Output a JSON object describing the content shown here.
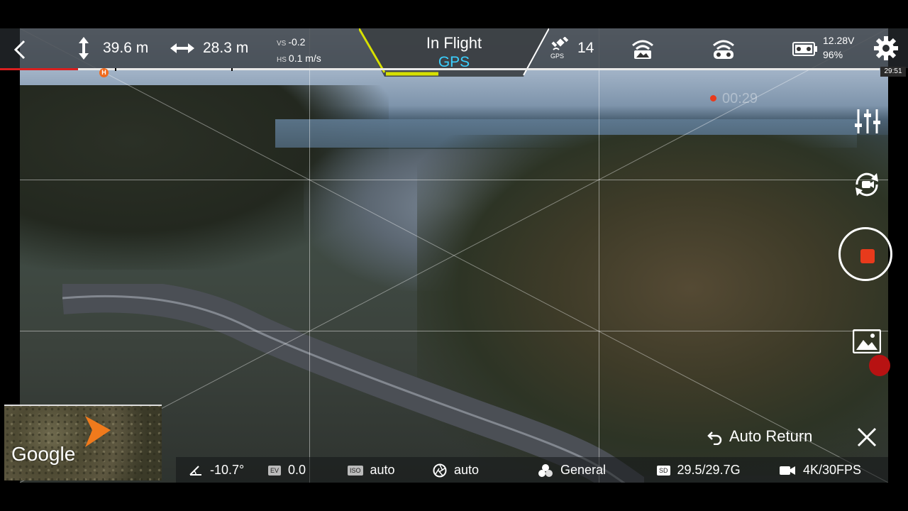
{
  "telemetry": {
    "altitude": "39.6 m",
    "distance": "28.3 m",
    "vs_label": "VS",
    "vs_value": "-0.2",
    "hs_label": "HS",
    "hs_value": "0.1 m/s"
  },
  "flight_status": {
    "state": "In Flight",
    "positioning": "GPS"
  },
  "gps": {
    "label": "GPS",
    "satellites": "14"
  },
  "battery": {
    "voltage": "12.28V",
    "percent": "96%"
  },
  "flight_time_remaining": "29:51",
  "home_marker": "H",
  "recording": {
    "elapsed": "00:29"
  },
  "bottom_bar": {
    "gimbal_pitch": "-10.7°",
    "ev_label": "EV",
    "ev_value": "0.0",
    "iso_label": "ISO",
    "iso_value": "auto",
    "shutter_value": "auto",
    "style_value": "General",
    "sd_label": "SD",
    "storage_value": "29.5/29.7G",
    "video_value": "4K/30FPS"
  },
  "actions": {
    "auto_return": "Auto Return"
  },
  "map": {
    "brand": "Google"
  },
  "colors": {
    "accent_gps": "#3ad0ff",
    "record_red": "#e83a1c",
    "status_yellow": "#d7e000",
    "home_orange": "#f06a1c"
  },
  "icons": {
    "back": "chevron-left-icon",
    "altitude": "vertical-arrows-icon",
    "distance": "horizontal-arrows-icon",
    "gps": "satellite-icon",
    "video_signal": "wifi-image-icon",
    "control_signal": "wifi-remote-icon",
    "battery": "drone-battery-icon",
    "settings": "gear-icon",
    "camera_settings": "sliders-icon",
    "camera_switch": "camera-switch-icon",
    "record": "record-stop-icon",
    "gallery": "gallery-icon",
    "close": "close-icon"
  }
}
